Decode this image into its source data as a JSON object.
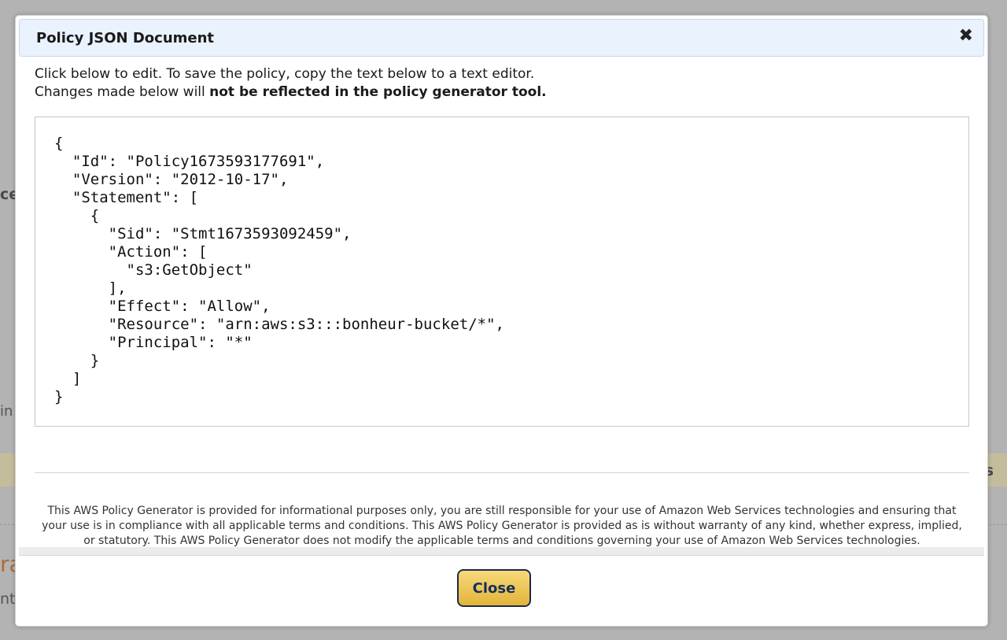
{
  "background": {
    "fragment_1": "ce",
    "fragment_2": "in",
    "fragment_3": "s",
    "fragment_4": "ra",
    "fragment_5": "nt"
  },
  "modal": {
    "title": "Policy JSON Document",
    "close_icon": "✖",
    "intro_line1": "Click below to edit. To save the policy, copy the text below to a text editor.",
    "intro_line2_prefix": "Changes made below will ",
    "intro_line2_bold": "not be reflected in the policy generator tool.",
    "policy_json": "{\n  \"Id\": \"Policy1673593177691\",\n  \"Version\": \"2012-10-17\",\n  \"Statement\": [\n    {\n      \"Sid\": \"Stmt1673593092459\",\n      \"Action\": [\n        \"s3:GetObject\"\n      ],\n      \"Effect\": \"Allow\",\n      \"Resource\": \"arn:aws:s3:::bonheur-bucket/*\",\n      \"Principal\": \"*\"\n    }\n  ]\n}",
    "disclaimer": "This AWS Policy Generator is provided for informational purposes only, you are still responsible for your use of Amazon Web Services technologies and ensuring that your use is in compliance with all applicable terms and conditions. This AWS Policy Generator is provided as is without warranty of any kind, whether express, implied, or statutory. This AWS Policy Generator does not modify the applicable terms and conditions governing your use of Amazon Web Services technologies.",
    "close_button_label": "Close"
  },
  "colors": {
    "header_bg": "#eaf2fd",
    "button_gold": "#e2b43a",
    "button_border": "#1b2a4d",
    "overlay": "#b3b3b3"
  }
}
